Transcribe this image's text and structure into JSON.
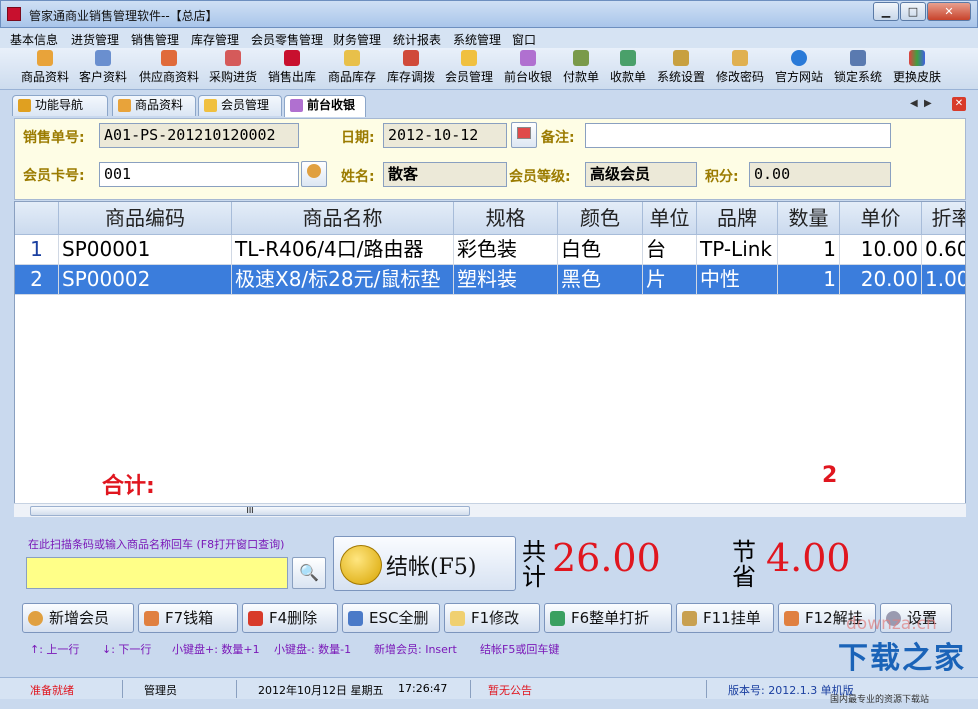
{
  "window": {
    "title": "管家通商业销售管理软件--【总店】",
    "minimize": "▁",
    "maximize": "□",
    "close": "✕"
  },
  "menu": [
    "基本信息",
    "进货管理",
    "销售管理",
    "库存管理",
    "会员零售管理",
    "财务管理",
    "统计报表",
    "系统管理",
    "窗口"
  ],
  "toolbar": [
    "商品资料",
    "客户资料",
    "供应商资料",
    "采购进货",
    "销售出库",
    "商品库存",
    "库存调拨",
    "会员管理",
    "前台收银",
    "付款单",
    "收款单",
    "系统设置",
    "修改密码",
    "官方网站",
    "锁定系统",
    "更换皮肤"
  ],
  "tabs": [
    "功能导航",
    "商品资料",
    "会员管理",
    "前台收银"
  ],
  "tab_nav": {
    "prev": "◀",
    "next": "▶",
    "close": "✕"
  },
  "form": {
    "sale_no_label": "销售单号:",
    "sale_no": "A01-PS-201210120002",
    "date_label": "日期:",
    "date": "2012-10-12",
    "note_label": "备注:",
    "note": "",
    "card_label": "会员卡号:",
    "card_no": "001",
    "name_label": "姓名:",
    "name": "散客",
    "level_label": "会员等级:",
    "level": "高级会员",
    "points_label": "积分:",
    "points": "0.00"
  },
  "table": {
    "headers": [
      "商品编码",
      "商品名称",
      "规格",
      "颜色",
      "单位",
      "品牌",
      "数量",
      "单价",
      "折率"
    ],
    "rows": [
      {
        "idx": "1",
        "code": "SP00001",
        "name": "TL-R406/4口/路由器",
        "spec": "彩色装",
        "color": "白色",
        "unit": "台",
        "brand": "TP-Link",
        "qty": "1",
        "price": "10.00",
        "rate": "0.60"
      },
      {
        "idx": "2",
        "code": "SP00002",
        "name": "极速X8/标28元/鼠标垫",
        "spec": "塑料装",
        "color": "黑色",
        "unit": "片",
        "brand": "中性",
        "qty": "1",
        "price": "20.00",
        "rate": "1.00"
      }
    ],
    "total_label": "合计:",
    "total_count": "2",
    "scroll_grip": "III"
  },
  "bottom": {
    "scan_hint": "在此扫描条码或输入商品名称回车 (F8打开窗口查询)",
    "scan_value": "",
    "checkout": "结帐(F5)",
    "total_label": "共计",
    "total_value": "26.00",
    "saved_label": "节省",
    "saved_value": "4.00"
  },
  "fbuttons": [
    "新增会员",
    "F7钱箱",
    "F4删除",
    "ESC全删",
    "F1修改",
    "F6整单打折",
    "F11挂单",
    "F12解挂",
    "设置"
  ],
  "hints": [
    "↑: 上一行",
    "↓: 下一行",
    "小键盘+: 数量+1",
    "小键盘-: 数量-1",
    "新增会员: Insert",
    "结帐F5或回车键"
  ],
  "watermark": {
    "cn": "下载之家",
    "en": "downza.cn",
    "tag": "国内最专业的资源下载站"
  },
  "status": {
    "state": "准备就绪",
    "user": "管理员",
    "date": "2012年10月12日 星期五",
    "time": "17:26:47",
    "notice": "暂无公告",
    "version": "版本号: 2012.1.3 单机版"
  },
  "colors": {
    "accent_red": "#e0161f",
    "hint_purple": "#7a18b8",
    "select_blue": "#3b7ddc",
    "form_bg": "#fefde5"
  }
}
